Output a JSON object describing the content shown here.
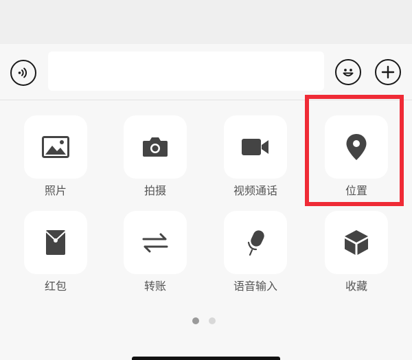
{
  "input_bar": {
    "text_value": "",
    "placeholder": ""
  },
  "panel": {
    "items": [
      {
        "label": "照片",
        "icon": "photo-icon"
      },
      {
        "label": "拍摄",
        "icon": "camera-icon"
      },
      {
        "label": "视频通话",
        "icon": "video-call-icon"
      },
      {
        "label": "位置",
        "icon": "location-pin-icon"
      },
      {
        "label": "红包",
        "icon": "red-packet-icon"
      },
      {
        "label": "转账",
        "icon": "transfer-arrows-icon"
      },
      {
        "label": "语音输入",
        "icon": "microphone-icon"
      },
      {
        "label": "收藏",
        "icon": "cube-icon"
      }
    ],
    "pager": {
      "pages": 2,
      "current": 1
    }
  },
  "highlight": {
    "target": "位置",
    "color": "#ef2b36"
  }
}
